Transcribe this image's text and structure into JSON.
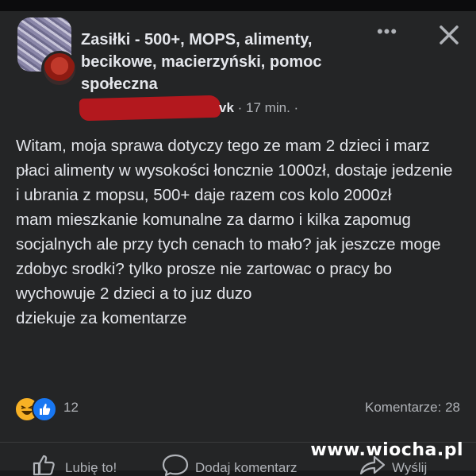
{
  "post": {
    "group_name": "Zasiłki - 500+, MOPS, alimenty, becikowe, macierzyński, pomoc społeczna",
    "author_tail": "vk",
    "time": "· 17 min. ·",
    "more_icon": "•••",
    "body": "Witam, moja sprawa dotyczy tego ze mam 2 dzieci i marz płaci alimenty w wysokości łoncznie 1000zł, dostaje jedzenie i ubrania z mopsu, 500+ daje razem cos kolo 2000zł\nmam mieszkanie komunalne za darmo i kilka zapomug socjalnych ale przy tych cenach to mało? jak jeszcze moge zdobyc srodki? tylko prosze nie zartowac o pracy bo wychowuje 2 dzieci a to juz duzo\ndziekuje za komentarze",
    "reaction_count": "12",
    "comments_label": "Komentarze: 28"
  },
  "actions": {
    "like": "Lubię to!",
    "comment": "Dodaj komentarz",
    "share": "Wyślij"
  },
  "watermark": "www.wiocha.pl",
  "colors": {
    "background": "#242526",
    "text": "#e4e6eb",
    "secondary": "#b0b3b8",
    "redaction": "#b3181e",
    "like_blue": "#1877f2",
    "haha_yellow": "#f7b125"
  }
}
